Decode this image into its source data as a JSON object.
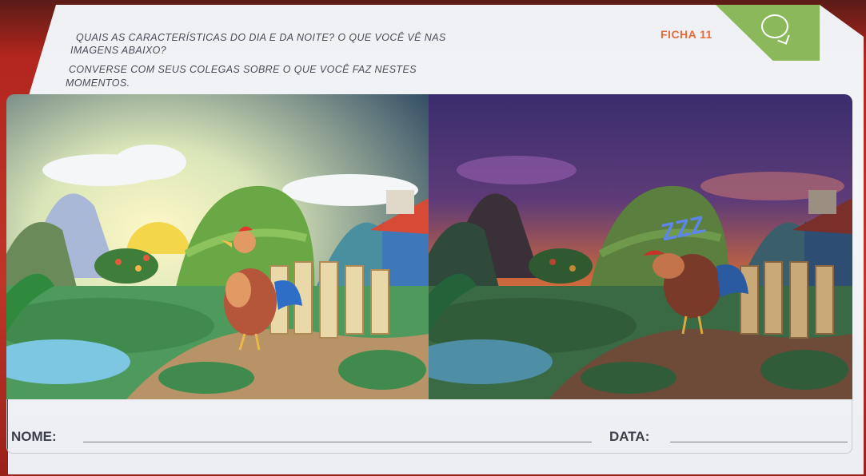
{
  "header": {
    "sheet_label": "FICHA 11",
    "instructions": [
      "QUAIS AS CARACTERÍSTICAS DO DIA E DA NOITE? O QUE VOCÊ VÊ NAS",
      "IMAGENS ABAIXO?",
      "CONVERSE COM SEUS COLEGAS SOBRE O QUE VOCÊ FAZ NESTES",
      "MOMENTOS."
    ]
  },
  "night_scene": {
    "sleep_text": "ZZZ"
  },
  "form": {
    "name_label": "NOME:",
    "date_label": "DATA:"
  },
  "colors": {
    "accent": "#8bb85a",
    "ficha": "#e86a3a",
    "paper": "#f0f1f5"
  }
}
